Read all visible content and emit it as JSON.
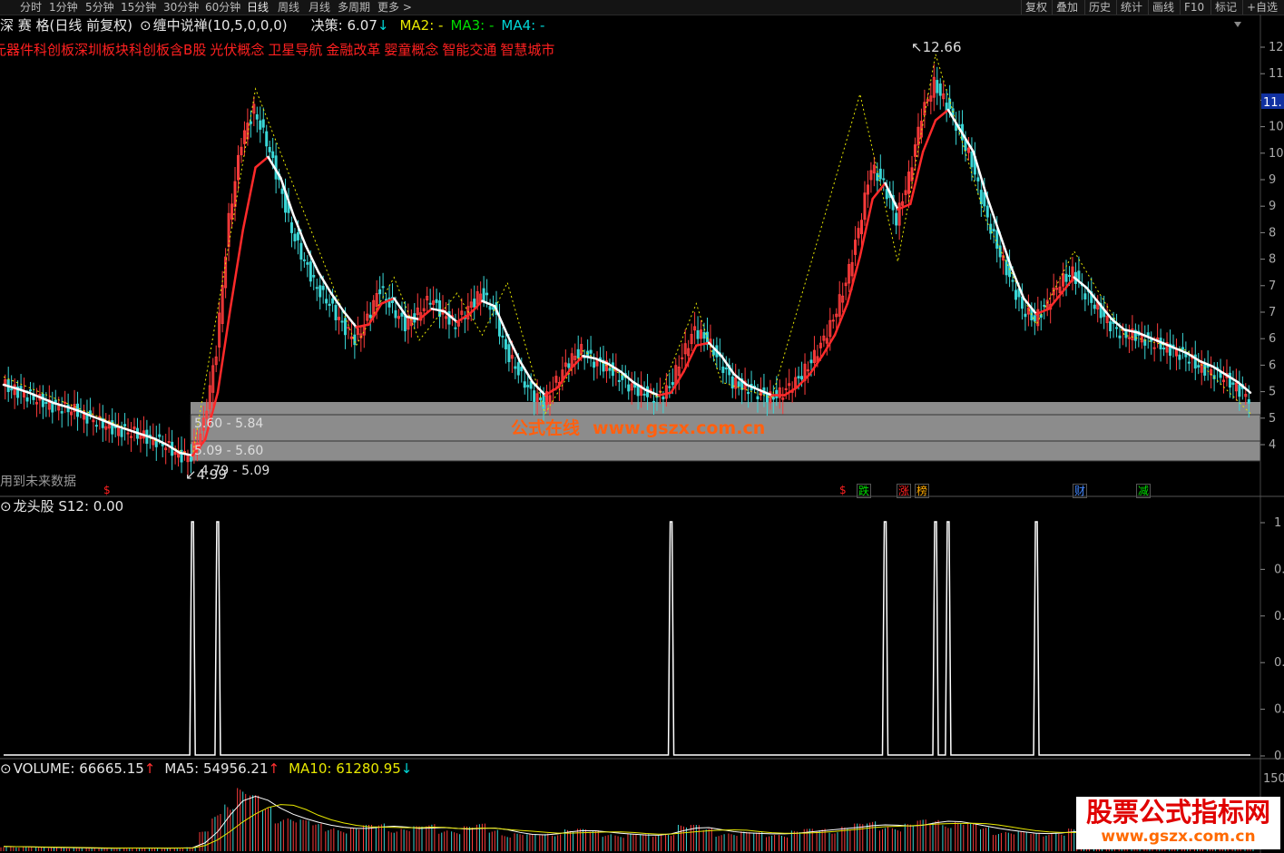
{
  "toolbar": {
    "periods": [
      "分时",
      "1分钟",
      "5分钟",
      "15分钟",
      "30分钟",
      "60分钟",
      "日线",
      "周线",
      "月线",
      "多周期",
      "更多 >"
    ],
    "active_period": "日线",
    "right_buttons": [
      "复权",
      "叠加",
      "历史",
      "统计",
      "画线",
      "F10",
      "标记",
      "+自选"
    ]
  },
  "header": {
    "stock": "深 赛 格(日线 前复权)",
    "indicator_name": "缠中说禅(10,5,0,0,0)",
    "decision_label": "决策: 6.07",
    "decision_arrow": "↓",
    "ma2": "MA2: -",
    "ma3": "MA3: -",
    "ma4": "MA4: -"
  },
  "concepts": [
    "元器件",
    "科创板",
    "深圳板块",
    "科创板含B股",
    "光伏概念",
    "卫星导航",
    "金融改革",
    "婴童概念",
    "智能交通",
    "智慧城市"
  ],
  "main_chart": {
    "price_axis_labels": [
      "12",
      "11",
      "11",
      "10",
      "10",
      "9",
      "9",
      "8",
      "8",
      "7",
      "7",
      "6",
      "6",
      "5",
      "5",
      "4"
    ],
    "current_price_tag": "11.",
    "high_label": "12.66",
    "low_label": "4.99",
    "zones": [
      {
        "label": "5.60 - 5.84"
      },
      {
        "label": "5.09 - 5.60"
      },
      {
        "label": "4.79 - 5.09"
      }
    ],
    "future_data_note": "用到未来数据",
    "badges": [
      {
        "text": "$",
        "color": "#ff2020"
      },
      {
        "text": "$",
        "color": "#ff2020"
      },
      {
        "text": "跌",
        "color": "#00dd00"
      },
      {
        "text": "涨",
        "color": "#ff2020"
      },
      {
        "text": "榜",
        "color": "#ffaa00"
      },
      {
        "text": "财",
        "color": "#4488ff"
      },
      {
        "text": "减",
        "color": "#00dd00"
      }
    ]
  },
  "watermark": {
    "site_name": "公式在线",
    "site_url": "www.gszx.com.cn",
    "logo_text": "股票公式指标网",
    "logo_url": "www.gszx.com.cn"
  },
  "sub_indicator": {
    "label": "龙头股 S12: 0.00",
    "axis_labels": [
      "1",
      "0.",
      "0.",
      "0.",
      "0.",
      "0"
    ]
  },
  "volume": {
    "volume_label": "VOLUME: 66665.15",
    "ma5_label": "MA5: 54956.21",
    "ma10_label": "MA10: 61280.95",
    "up_arrow": "↑",
    "down_arrow": "↓",
    "axis_label": "150"
  },
  "chart_data": {
    "type": "line",
    "close": [
      6.35,
      6.25,
      6.15,
      6.05,
      5.95,
      5.9,
      5.85,
      5.7,
      5.6,
      5.5,
      5.45,
      5.4,
      5.3,
      5.2,
      5.0,
      4.99,
      5.6,
      7.0,
      9.5,
      11.0,
      11.6,
      11.0,
      10.2,
      9.3,
      8.7,
      8.2,
      7.9,
      7.5,
      7.2,
      7.6,
      8.2,
      7.8,
      7.5,
      7.7,
      8.0,
      7.7,
      7.5,
      7.8,
      8.1,
      7.8,
      7.0,
      6.6,
      6.2,
      6.0,
      6.4,
      6.8,
      7.0,
      6.8,
      6.7,
      6.5,
      6.3,
      6.2,
      6.1,
      6.3,
      6.9,
      7.4,
      7.2,
      6.8,
      6.4,
      6.3,
      6.2,
      6.1,
      6.2,
      6.4,
      6.7,
      7.1,
      7.6,
      8.3,
      9.3,
      10.5,
      10.2,
      9.5,
      10.3,
      11.5,
      12.1,
      11.7,
      11.2,
      10.6,
      9.7,
      9.0,
      8.4,
      7.8,
      7.6,
      7.9,
      8.3,
      8.5,
      8.1,
      7.8,
      7.5,
      7.3,
      7.3,
      7.2,
      7.1,
      7.0,
      6.9,
      6.7,
      6.6,
      6.5,
      6.3,
      6.1
    ],
    "ma_white": [
      6.35,
      6.28,
      6.2,
      6.1,
      6.0,
      5.93,
      5.85,
      5.75,
      5.66,
      5.56,
      5.48,
      5.4,
      5.32,
      5.2,
      5.05,
      5.0,
      5.3,
      6.2,
      7.8,
      9.3,
      10.5,
      10.7,
      10.3,
      9.6,
      9.0,
      8.5,
      8.1,
      7.75,
      7.45,
      7.5,
      7.9,
      8.0,
      7.65,
      7.6,
      7.8,
      7.75,
      7.55,
      7.7,
      7.95,
      7.85,
      7.3,
      6.8,
      6.4,
      6.15,
      6.3,
      6.65,
      6.9,
      6.85,
      6.75,
      6.6,
      6.4,
      6.25,
      6.15,
      6.2,
      6.6,
      7.1,
      7.15,
      6.9,
      6.55,
      6.35,
      6.25,
      6.15,
      6.15,
      6.3,
      6.55,
      6.9,
      7.3,
      7.9,
      8.8,
      9.9,
      10.2,
      9.7,
      9.8,
      10.8,
      11.4,
      11.6,
      11.2,
      10.8,
      10.0,
      9.3,
      8.6,
      8.0,
      7.7,
      7.8,
      8.1,
      8.4,
      8.2,
      7.9,
      7.6,
      7.4,
      7.35,
      7.25,
      7.15,
      7.05,
      6.95,
      6.8,
      6.7,
      6.55,
      6.4,
      6.2
    ],
    "zigzag": [
      [
        0,
        6.5
      ],
      [
        15,
        4.99
      ],
      [
        20,
        12.0
      ],
      [
        28,
        7.1
      ],
      [
        31,
        8.4
      ],
      [
        33,
        7.2
      ],
      [
        36,
        8.1
      ],
      [
        38,
        7.3
      ],
      [
        40,
        8.3
      ],
      [
        43,
        5.8
      ],
      [
        46,
        7.0
      ],
      [
        48,
        6.7
      ],
      [
        52,
        6.1
      ],
      [
        55,
        7.9
      ],
      [
        57,
        6.4
      ],
      [
        61,
        6.1
      ],
      [
        68,
        11.9
      ],
      [
        71,
        8.7
      ],
      [
        74,
        12.66
      ],
      [
        78,
        9.5
      ],
      [
        82,
        7.5
      ],
      [
        85,
        8.9
      ],
      [
        89,
        7.3
      ],
      [
        94,
        7.0
      ],
      [
        99,
        5.8
      ]
    ],
    "s12_spikes": [
      15,
      17,
      53,
      70,
      74,
      75,
      82
    ],
    "volume": [
      8,
      7,
      7,
      6,
      6,
      6,
      5,
      5,
      5,
      5,
      6,
      5,
      5,
      5,
      6,
      6,
      30,
      62,
      90,
      100,
      85,
      70,
      60,
      55,
      48,
      42,
      40,
      38,
      36,
      40,
      45,
      40,
      36,
      38,
      42,
      38,
      34,
      38,
      42,
      36,
      30,
      28,
      26,
      28,
      33,
      36,
      34,
      32,
      30,
      28,
      27,
      26,
      27,
      34,
      42,
      40,
      36,
      32,
      30,
      30,
      29,
      28,
      30,
      32,
      34,
      36,
      38,
      40,
      42,
      46,
      44,
      40,
      42,
      48,
      52,
      50,
      46,
      42,
      38,
      35,
      32,
      30,
      28,
      30,
      33,
      35,
      32,
      30,
      28,
      26,
      25,
      24,
      23,
      22,
      21,
      20,
      20,
      19,
      18,
      18
    ],
    "ylim": [
      4.6,
      12.9
    ]
  }
}
